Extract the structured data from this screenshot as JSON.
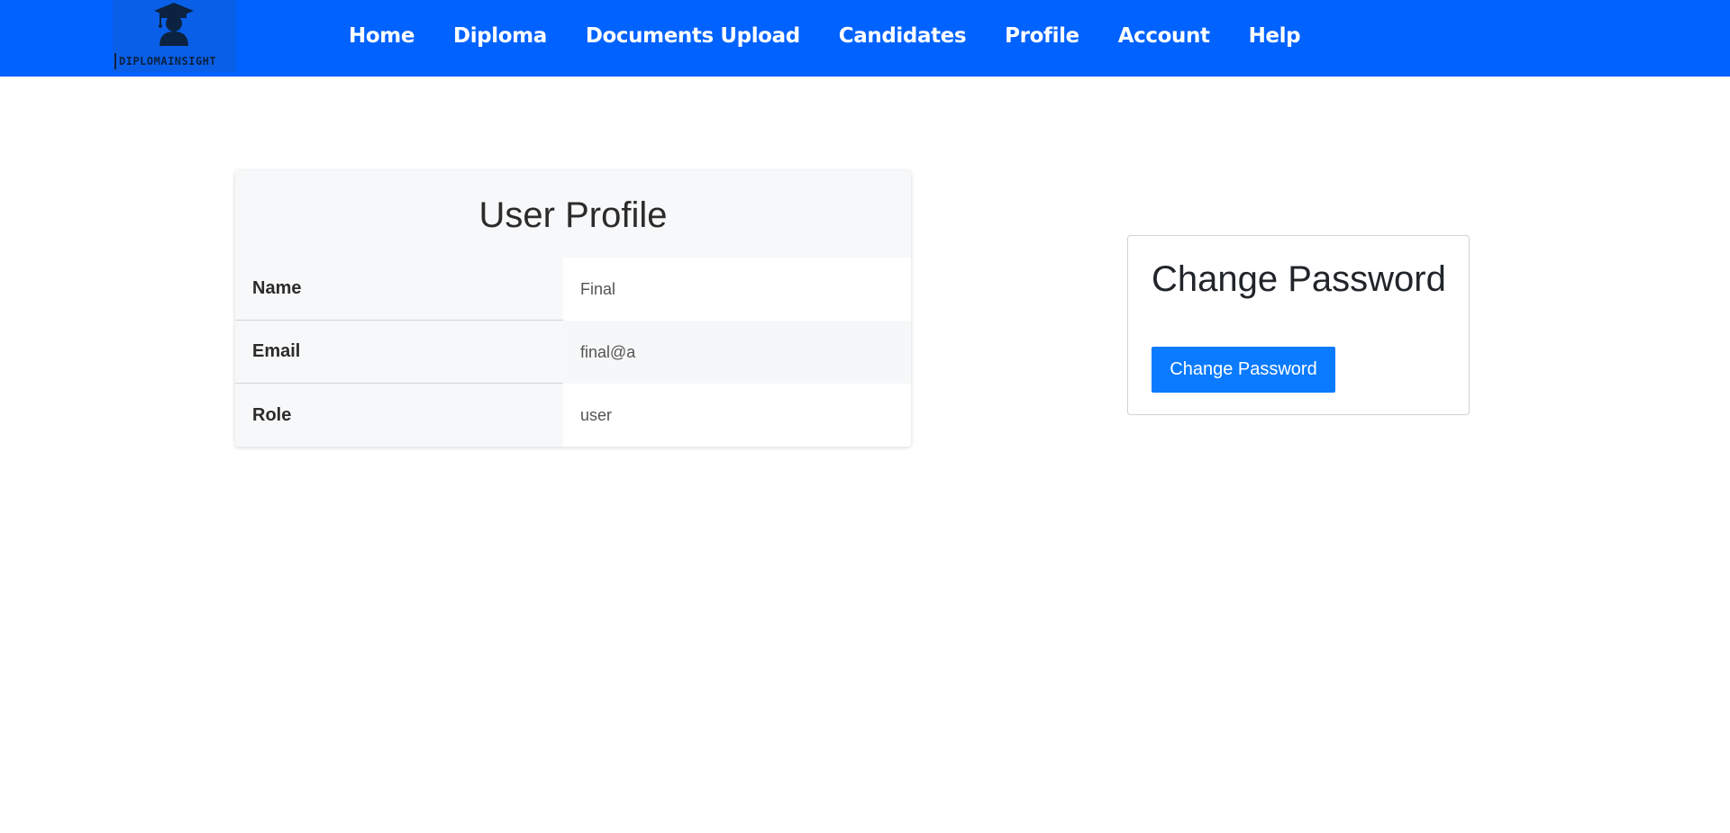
{
  "brand": {
    "name": "DIPLOMAINSIGHT",
    "icon": "graduate-icon",
    "colors": {
      "navbar": "#0062ff",
      "logo_dark": "#0b2340"
    }
  },
  "nav": {
    "items": [
      {
        "label": "Home"
      },
      {
        "label": "Diploma"
      },
      {
        "label": "Documents Upload"
      },
      {
        "label": "Candidates"
      },
      {
        "label": "Profile"
      },
      {
        "label": "Account"
      },
      {
        "label": "Help"
      }
    ]
  },
  "profile": {
    "title": "User Profile",
    "fields": [
      {
        "label": "Name",
        "value": "Final"
      },
      {
        "label": "Email",
        "value": "final@a"
      },
      {
        "label": "Role",
        "value": "user"
      }
    ]
  },
  "password": {
    "title": "Change Password",
    "button_label": "Change Password",
    "button_color": "#0a7bff"
  }
}
